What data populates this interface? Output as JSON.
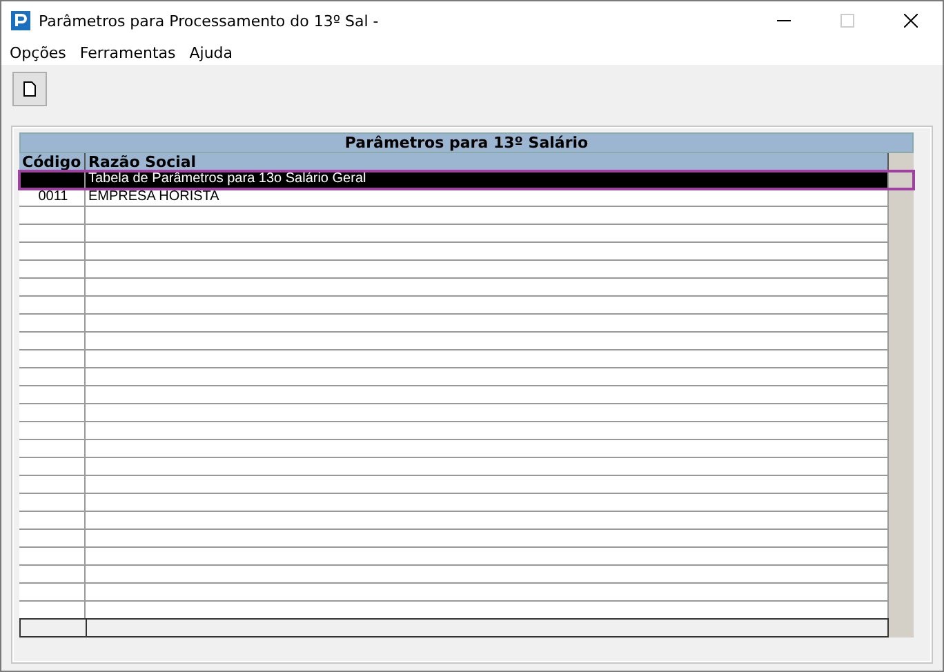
{
  "window": {
    "title": "Parâmetros para Processamento do 13º Sal -"
  },
  "menu": [
    "Opções",
    "Ferramentas",
    "Ajuda"
  ],
  "grid": {
    "title": "Parâmetros para 13º Salário",
    "columns": [
      "Código",
      "Razão Social"
    ],
    "rows": [
      {
        "code": "",
        "name": "Tabela de Parâmetros para 13o Salário Geral",
        "selected": true
      },
      {
        "code": "0011",
        "name": "EMPRESA HORISTA",
        "selected": false
      }
    ]
  }
}
